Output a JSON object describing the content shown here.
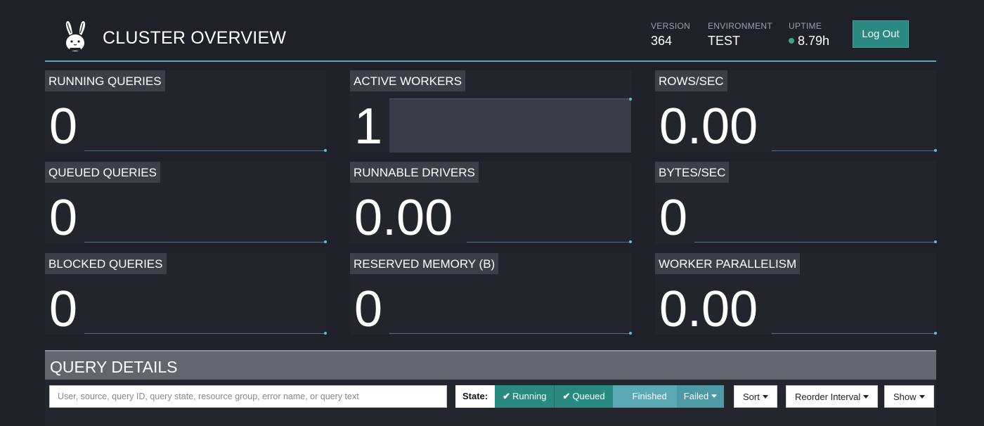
{
  "header": {
    "title": "CLUSTER OVERVIEW",
    "version_label": "VERSION",
    "version_value": "364",
    "environment_label": "ENVIRONMENT",
    "environment_value": "TEST",
    "uptime_label": "UPTIME",
    "uptime_value": "8.79h",
    "logout_label": "Log Out"
  },
  "stats": {
    "running_queries": {
      "label": "RUNNING QUERIES",
      "value": "0"
    },
    "active_workers": {
      "label": "ACTIVE WORKERS",
      "value": "1"
    },
    "rows_sec": {
      "label": "ROWS/SEC",
      "value": "0.00"
    },
    "queued_queries": {
      "label": "QUEUED QUERIES",
      "value": "0"
    },
    "runnable_drivers": {
      "label": "RUNNABLE DRIVERS",
      "value": "0.00"
    },
    "bytes_sec": {
      "label": "BYTES/SEC",
      "value": "0"
    },
    "blocked_queries": {
      "label": "BLOCKED QUERIES",
      "value": "0"
    },
    "reserved_memory": {
      "label": "RESERVED MEMORY (B)",
      "value": "0"
    },
    "worker_parallelism": {
      "label": "WORKER PARALLELISM",
      "value": "0.00"
    }
  },
  "query_details": {
    "title": "QUERY DETAILS",
    "search_placeholder": "User, source, query ID, query state, resource group, error name, or query text",
    "state_label": "State:",
    "state_running": "Running",
    "state_queued": "Queued",
    "state_finished": "Finished",
    "state_failed": "Failed",
    "sort_label": "Sort",
    "reorder_label": "Reorder Interval",
    "show_label": "Show"
  },
  "colors": {
    "accent": "#2a8a81",
    "header_rule": "#5ea8b3",
    "background": "#1f2128",
    "label_bg": "#3b3f48"
  }
}
